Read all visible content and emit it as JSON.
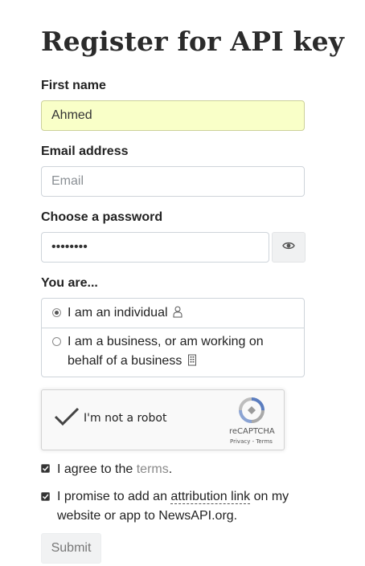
{
  "page": {
    "title": "Register for API key"
  },
  "form": {
    "first_name": {
      "label": "First name",
      "value": "Ahmed"
    },
    "email": {
      "label": "Email address",
      "placeholder": "Email",
      "value": ""
    },
    "password": {
      "label": "Choose a password",
      "masked_value": "••••••••"
    },
    "you_are": {
      "label": "You are...",
      "options": [
        {
          "text": "I am an individual",
          "icon": "person-icon",
          "selected": true
        },
        {
          "text_line1": "I am a business, or am working on",
          "text_line2": "behalf of a business",
          "icon": "building-icon",
          "selected": false
        }
      ]
    },
    "recaptcha": {
      "label": "I'm not a robot",
      "brand": "reCAPTCHA",
      "links": "Privacy - Terms",
      "checked": true
    },
    "agree": {
      "prefix": "I agree to the ",
      "link": "terms",
      "suffix": ".",
      "checked": true
    },
    "attribution": {
      "prefix": "I promise to add an ",
      "link": "attribution link",
      "suffix_line1": " on my",
      "line2": "website or app to NewsAPI.org.",
      "checked": true
    },
    "submit_label": "Submit"
  }
}
